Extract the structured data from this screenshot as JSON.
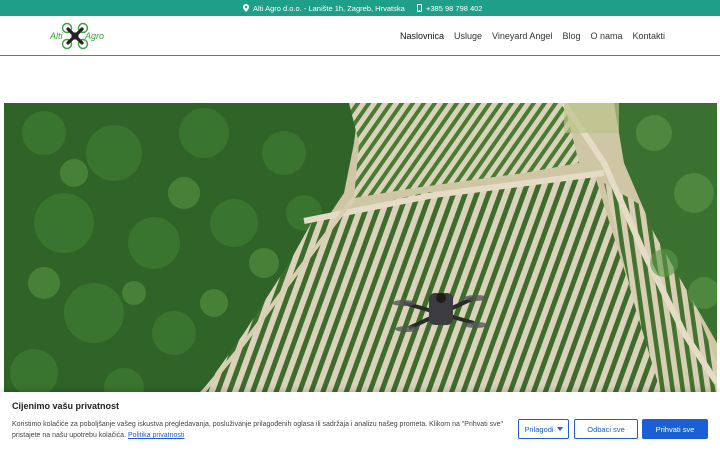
{
  "topbar": {
    "address": "Alti Agro d.o.o. - Lanište 1h, Zagreb, Hrvatska",
    "phone": "+385 98 798 402",
    "background_color": "#1f9e8a"
  },
  "logo": {
    "left_text": "Alti",
    "right_text": "Agro",
    "icon": "drone-logo-icon"
  },
  "nav": {
    "items": [
      {
        "label": "Naslovnica",
        "active": true
      },
      {
        "label": "Usluge"
      },
      {
        "label": "Vineyard Angel"
      },
      {
        "label": "Blog"
      },
      {
        "label": "O nama"
      },
      {
        "label": "Kontakti"
      }
    ]
  },
  "hero": {
    "subject": "aerial-vineyard-drone-photo"
  },
  "cookie": {
    "title": "Cijenimo vašu privatnost",
    "text": "Koristimo kolačiće za poboljšanje vašeg iskustva pregledavanja, posluživanje prilagođenih oglasa ili sadržaja i analizu našeg prometa. Klikom na \"Prihvati sve\" pristajete na našu upotrebu kolačića.",
    "policy_link": "Politika privatnosti",
    "buttons": {
      "customize": "Prilagodi",
      "reject": "Odbaci sve",
      "accept": "Prihvati sve"
    },
    "accent_color": "#1a5fd6"
  }
}
